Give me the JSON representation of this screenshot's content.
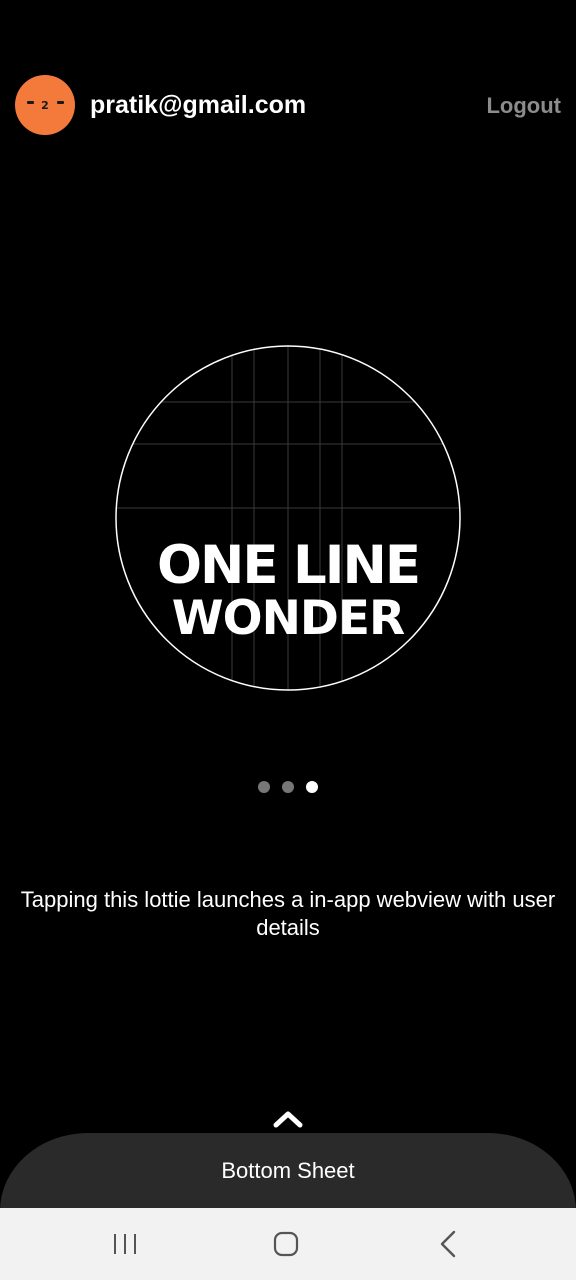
{
  "header": {
    "email": "pratik@gmail.com",
    "logout_label": "Logout",
    "avatar_mouth": "2"
  },
  "lottie": {
    "line1": "ONE LINE",
    "line2": "WONDER"
  },
  "pager": {
    "count": 3,
    "active_index": 2
  },
  "caption": "Tapping this lottie launches a in-app webview with user details",
  "bottom_sheet": {
    "label": "Bottom Sheet",
    "icon": "chevron-up-icon"
  },
  "navbar": {
    "icons": [
      "recents-icon",
      "home-icon",
      "back-icon"
    ]
  },
  "colors": {
    "background": "#000000",
    "avatar": "#f47a3c",
    "logout": "#8c8c8c",
    "sheet": "#2a2a2a",
    "navbar": "#f2f2f2"
  }
}
